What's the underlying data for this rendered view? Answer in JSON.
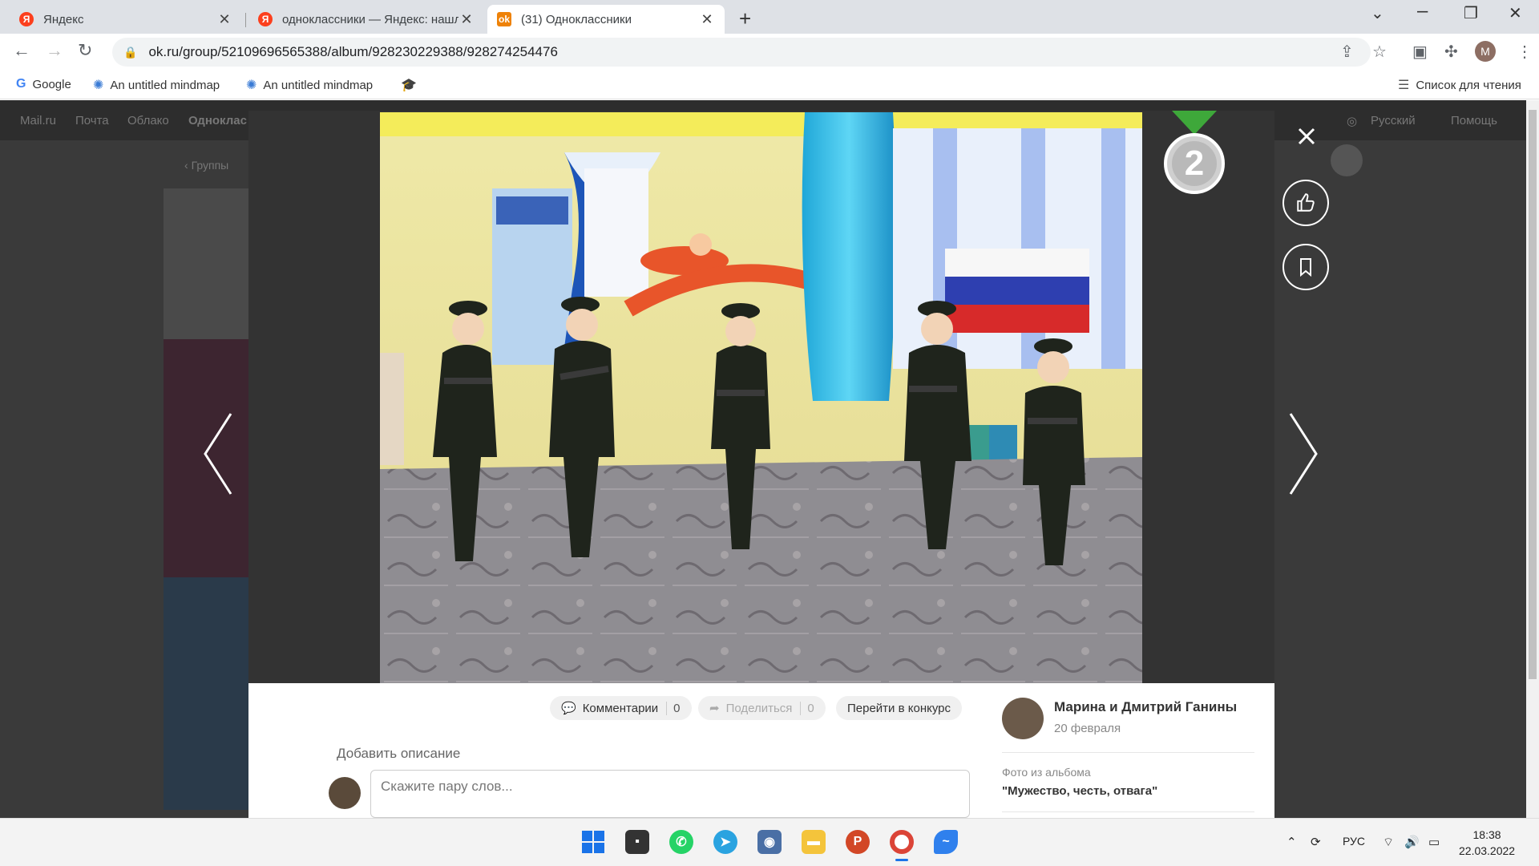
{
  "browser": {
    "tabs": [
      {
        "title": "Яндекс",
        "favicon": "yandex-icon"
      },
      {
        "title": "одноклассники — Яндекс: нашл",
        "favicon": "yandex-icon"
      },
      {
        "title": "(31) Одноклассники",
        "favicon": "ok-icon",
        "active": true
      }
    ],
    "url": "ok.ru/group/52109696565388/album/928230229388/928274254476",
    "profile_initial": "M",
    "bookmarks": [
      {
        "label": "Google",
        "icon": "google-icon"
      },
      {
        "label": "An untitled mindmap",
        "icon": "mindmap-icon"
      },
      {
        "label": "An untitled mindmap",
        "icon": "mindmap-icon"
      }
    ],
    "reading_list": "Список для чтения"
  },
  "page_bg": {
    "nav": [
      "Mail.ru",
      "Почта",
      "Облако",
      "Одноклас"
    ],
    "lang": "Русский",
    "help": "Помощь",
    "groups_link": "Группы"
  },
  "viewer": {
    "badge_number": "2",
    "actions": {
      "comments_label": "Комментарии",
      "comments_count": "0",
      "share_label": "Поделиться",
      "share_count": "0",
      "contest_label": "Перейти в конкурс"
    },
    "description_placeholder": "Добавить описание",
    "comment_placeholder": "Скажите пару слов...",
    "author": "Марина и Дмитрий Ганины",
    "date": "20 февраля",
    "album_label": "Фото из альбома",
    "album_name": "\"Мужество, честь, отвага\""
  },
  "colors": {
    "ok_orange": "#ee8208",
    "yandex_red": "#fc3f1d",
    "overlay": "#333333"
  },
  "taskbar": {
    "lang": "РУС",
    "time": "18:38",
    "date": "22.03.2022"
  }
}
